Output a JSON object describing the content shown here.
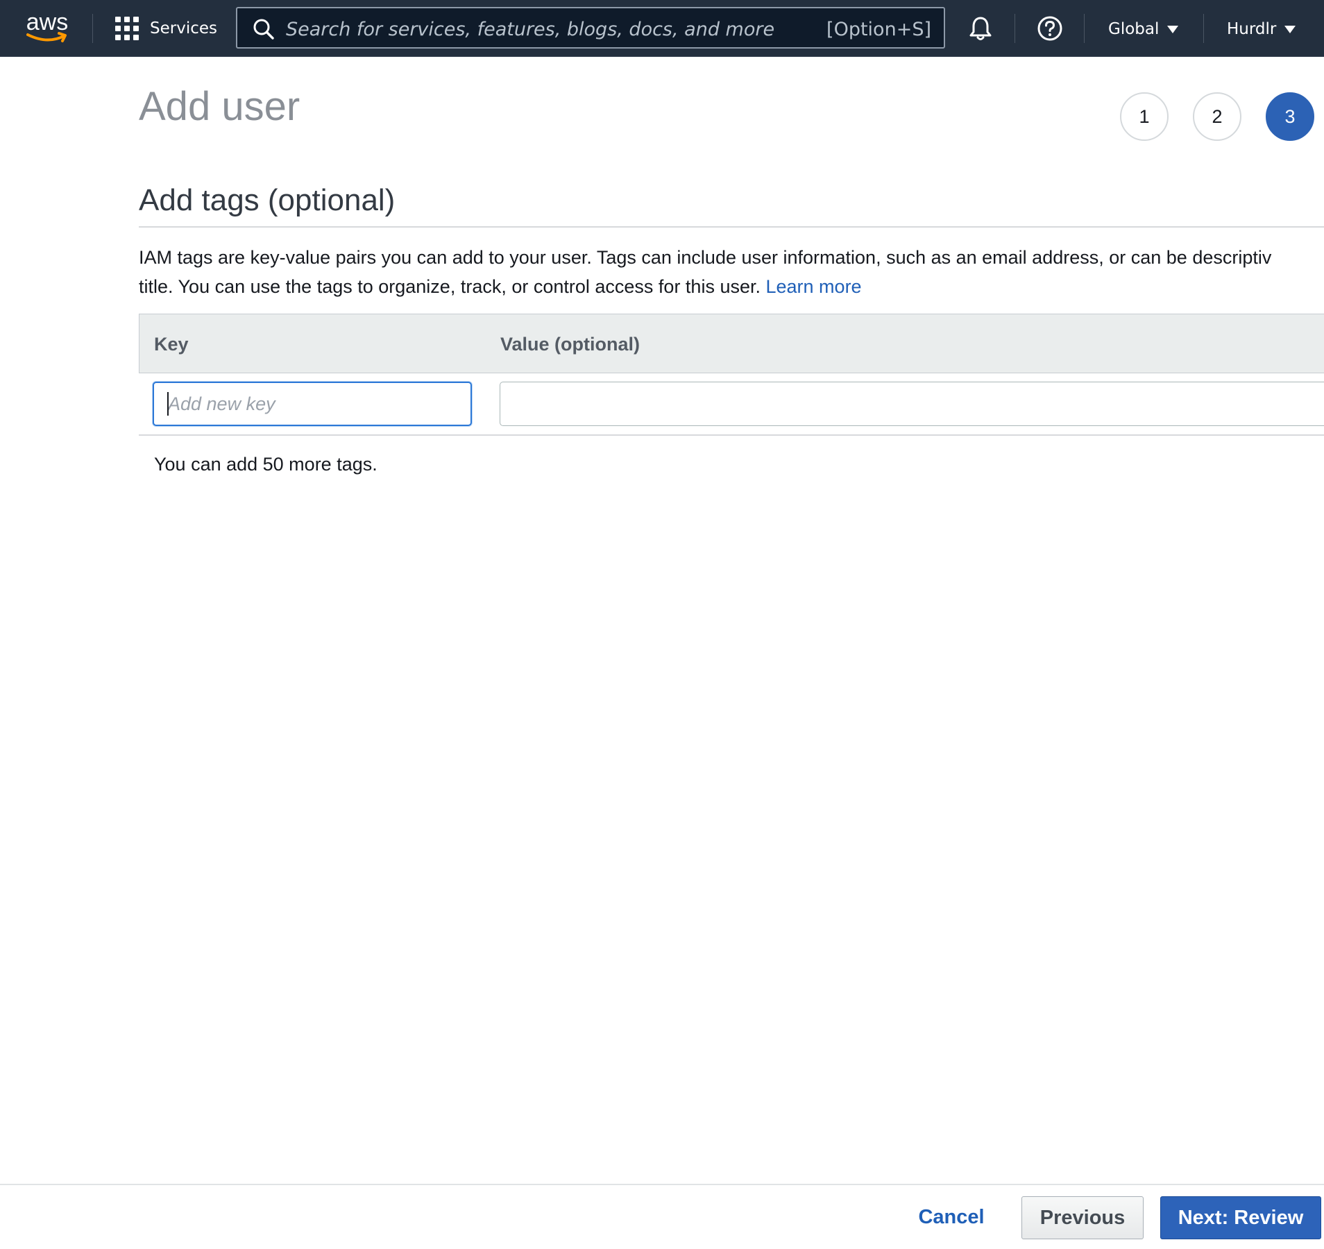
{
  "nav": {
    "logo_text": "aws",
    "services_label": "Services",
    "search_placeholder": "Search for services, features, blogs, docs, and more",
    "search_shortcut": "[Option+S]",
    "region_label": "Global",
    "account_label": "Hurdlr"
  },
  "header": {
    "title": "Add user",
    "steps": [
      "1",
      "2",
      "3"
    ],
    "active_step": "3"
  },
  "section": {
    "title": "Add tags (optional)",
    "description_line1": "IAM tags are key-value pairs you can add to your user. Tags can include user information, such as an email address, or can be descriptiv",
    "description_line2": "title. You can use the tags to organize, track, or control access for this user.",
    "learn_more": "Learn more"
  },
  "table": {
    "columns": [
      "Key",
      "Value (optional)"
    ],
    "key_placeholder": "Add new key",
    "key_value": "",
    "value_value": "",
    "tags_remaining": "You can add 50 more tags."
  },
  "footer": {
    "cancel_label": "Cancel",
    "previous_label": "Previous",
    "next_label": "Next: Review"
  },
  "colors": {
    "nav_bg": "#232f3e",
    "primary_blue": "#2d63b9",
    "link_blue": "#1f5fb7",
    "focus_border": "#2c78d7"
  }
}
